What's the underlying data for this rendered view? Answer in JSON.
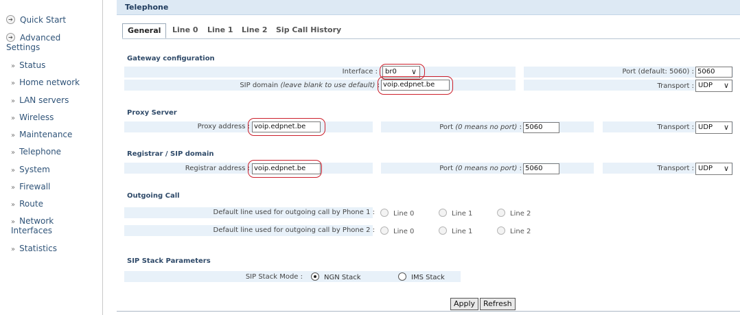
{
  "sidebar": {
    "quick_start": "Quick Start",
    "advanced_line1": "Advanced",
    "advanced_line2": "Settings",
    "items": [
      {
        "label": "Status"
      },
      {
        "label": "Home network"
      },
      {
        "label": "LAN servers"
      },
      {
        "label": "Wireless"
      },
      {
        "label": "Maintenance"
      },
      {
        "label": "Telephone"
      },
      {
        "label": "System"
      },
      {
        "label": "Firewall"
      },
      {
        "label": "Route"
      },
      {
        "label": "Network",
        "label2": "Interfaces"
      },
      {
        "label": "Statistics"
      }
    ],
    "arrow_glyph": "»"
  },
  "page": {
    "title": "Telephone",
    "tabs": [
      "General",
      "Line 0",
      "Line 1",
      "Line 2",
      "Sip Call History"
    ],
    "active_tab": "General"
  },
  "gateway": {
    "title": "Gateway configuration",
    "interface_label": "Interface :",
    "interface_value": "br0",
    "sip_domain_label": "SIP domain",
    "sip_domain_hint": "(leave blank to use default)",
    "sip_domain_value": "voip.edpnet.be",
    "port_label": "Port (default: 5060) :",
    "port_value": "5060",
    "transport_label": "Transport :",
    "transport_value": "UDP"
  },
  "proxy": {
    "title": "Proxy Server",
    "address_label": "Proxy address :",
    "address_value": "voip.edpnet.be",
    "port_label": "Port",
    "port_hint": "(0 means no port)",
    "port_value": "5060",
    "transport_label": "Transport :",
    "transport_value": "UDP"
  },
  "registrar": {
    "title": "Registrar / SIP domain",
    "address_label": "Registrar address :",
    "address_value": "voip.edpnet.be",
    "port_label": "Port",
    "port_hint": "(0 means no port)",
    "port_value": "5060",
    "transport_label": "Transport :",
    "transport_value": "UDP"
  },
  "outgoing": {
    "title": "Outgoing Call",
    "phone1_label": "Default line used for outgoing call by Phone 1 :",
    "phone2_label": "Default line used for outgoing call by Phone 2 :",
    "options": [
      "Line 0",
      "Line 1",
      "Line 2"
    ]
  },
  "sip_stack": {
    "title": "SIP Stack Parameters",
    "mode_label": "SIP Stack Mode :",
    "options": [
      "NGN Stack",
      "IMS Stack"
    ],
    "selected": "NGN Stack"
  },
  "buttons": {
    "apply": "Apply",
    "refresh": "Refresh"
  },
  "colors": {
    "highlight": "#cc1e2a",
    "row_bg": "#e8f1f9",
    "title_bar_bg": "#dde9f4",
    "link": "#2f5378"
  }
}
